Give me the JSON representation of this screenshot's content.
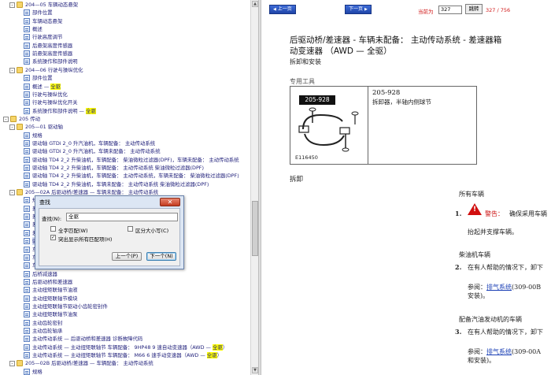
{
  "tree": {
    "rows": [
      {
        "depth": 1,
        "type": "folder",
        "toggle": "-",
        "label": "204—05 车辆动态悬架"
      },
      {
        "depth": 2,
        "type": "doc",
        "label": "部件位置"
      },
      {
        "depth": 2,
        "type": "doc",
        "label": "车辆动态悬架"
      },
      {
        "depth": 2,
        "type": "doc",
        "label": "概述"
      },
      {
        "depth": 2,
        "type": "doc",
        "label": "行驶高度调节"
      },
      {
        "depth": 2,
        "type": "doc",
        "label": "后悬架高度传感器"
      },
      {
        "depth": 2,
        "type": "doc",
        "label": "前悬架高度传感器"
      },
      {
        "depth": 2,
        "type": "doc",
        "label": "系统操作和部件说明"
      },
      {
        "depth": 1,
        "type": "folder",
        "toggle": "-",
        "label": "204—06 行驶与操纵优化"
      },
      {
        "depth": 2,
        "type": "doc",
        "label": "部件位置"
      },
      {
        "depth": 2,
        "type": "doc",
        "label": "概述 — ",
        "hl": "全驱",
        "after": ""
      },
      {
        "depth": 2,
        "type": "doc",
        "label": "行驶与操纵优化"
      },
      {
        "depth": 2,
        "type": "doc",
        "label": "行驶与操纵优化开关"
      },
      {
        "depth": 2,
        "type": "doc",
        "label": "系统操作和部件说明 — ",
        "hl": "全驱",
        "after": ""
      },
      {
        "depth": 0,
        "type": "folder",
        "toggle": "-",
        "label": "205 传动"
      },
      {
        "depth": 1,
        "type": "folder",
        "toggle": "-",
        "label": "205—01 驱动轴"
      },
      {
        "depth": 2,
        "type": "doc",
        "label": "规格"
      },
      {
        "depth": 2,
        "type": "doc",
        "label": "驱动轴 GTDi 2_0 升汽油机，车辆配备： 主动传动系统"
      },
      {
        "depth": 2,
        "type": "doc",
        "label": "驱动轴 GTDi 2_0 升汽油机，车辆未配备： 主动传动系统"
      },
      {
        "depth": 2,
        "type": "doc",
        "label": "驱动轴 TD4 2_2 升柴油机，车辆配备： 柴油微粒过滤器(DPF)，车辆未配备： 主动传动系统"
      },
      {
        "depth": 2,
        "type": "doc",
        "label": "驱动轴 TD4 2_2 升柴油机，车辆配备： 主动传动系统 柴油微粒过滤器(DPF)"
      },
      {
        "depth": 2,
        "type": "doc",
        "label": "驱动轴 TD4 2_2 升柴油机，车辆配备： 主动传动系统，车辆未配备： 柴油微粒过滤器(DPF)"
      },
      {
        "depth": 2,
        "type": "doc",
        "label": "驱动轴 TD4 2_2 升柴油机，车辆未配备： 主动传动系统 柴油微粒过滤器(DPF)"
      },
      {
        "depth": 1,
        "type": "folder",
        "toggle": "-",
        "label": "205—02A 后驱动桥/差速器 — 车辆未配备： 主动传动系统"
      },
      {
        "depth": 2,
        "type": "doc",
        "label": "规格"
      },
      {
        "depth": 2,
        "type": "doc",
        "label": "差速"
      },
      {
        "depth": 2,
        "type": "doc",
        "label": "差速"
      },
      {
        "depth": 2,
        "type": "doc",
        "label": "差速"
      },
      {
        "depth": 2,
        "type": "doc",
        "label": "差速"
      },
      {
        "depth": 2,
        "type": "doc",
        "label": "驱动                                                                变速器（AWD — ",
        "hl": "全驱",
        "after": "）",
        "selected": true
      },
      {
        "depth": 2,
        "type": "doc",
        "label": "车辆                                                                 （AWD — ",
        "hl": "全驱",
        "after": "）"
      },
      {
        "depth": 2,
        "type": "doc",
        "label": "车辆                                                                 动变速器（AWD — ",
        "hl": "全驱",
        "after": "）"
      },
      {
        "depth": 2,
        "type": "doc",
        "label": "车辆                                                                   动变速器（AWD — ",
        "hl": "全驱",
        "after": "）"
      },
      {
        "depth": 2,
        "type": "doc",
        "label": "后桥减速器"
      },
      {
        "depth": 2,
        "type": "doc",
        "label": "后驱动桥和差速器"
      },
      {
        "depth": 2,
        "type": "doc",
        "label": "主动扭矩联轴节油液"
      },
      {
        "depth": 2,
        "type": "doc",
        "label": "主动扭矩联轴节模块"
      },
      {
        "depth": 2,
        "type": "doc",
        "label": "主动扭矩联轴节驱动小齿轮密封件"
      },
      {
        "depth": 2,
        "type": "doc",
        "label": "主动扭矩联轴节油泵"
      },
      {
        "depth": 2,
        "type": "doc",
        "label": "主动齿轮密封"
      },
      {
        "depth": 2,
        "type": "doc",
        "label": "主动齿轮轴承"
      },
      {
        "depth": 2,
        "type": "doc",
        "label": "主动传动系统 — 后驱动桥和差速器 诊断故障代码"
      },
      {
        "depth": 2,
        "type": "doc",
        "label": "主动传动系统 — 主动扭矩联轴节 车辆配备： 9HP48 9 速自动变速器（AWD — ",
        "hl": "全驱",
        "after": "）"
      },
      {
        "depth": 2,
        "type": "doc",
        "label": "主动传动系统 — 主动扭矩联轴节 车辆配备： M66 6 速手动变速器（AWD — ",
        "hl": "全驱",
        "after": "）"
      },
      {
        "depth": 1,
        "type": "folder",
        "toggle": "-",
        "label": "205—02B 后驱动桥/差速器 — 车辆配备： 主动传动系统"
      },
      {
        "depth": 2,
        "type": "doc",
        "label": "规格"
      }
    ]
  },
  "toolbar": {
    "prev_label": "上一页",
    "next_label": "下一页",
    "page_label": "当前为",
    "page_value": "327",
    "jump_label": "跳转",
    "page_count": "327 / 756"
  },
  "document": {
    "title_line1": "后驱动桥/差速器 - 车辆未配备： 主动传动系统 - 差速器箱",
    "title_line2": "动变速器 （AWD — 全驱）",
    "subtitle": "拆卸和安装",
    "tools_heading": "专用工具",
    "tool_badge": "205-928",
    "tool_number": "205-928",
    "tool_desc": "拆卸器，半轴内侧球节",
    "tool_img_code": "E116450",
    "removal_heading": "拆卸",
    "all_vehicles": "所有车辆",
    "step1_num": "1.",
    "step1_warn": "警告：",
    "step1_text": "确保采用车辆",
    "step1_cont": "抬起并支撑车辆。",
    "diesel_heading": "柴油机车辆",
    "step2_num": "2.",
    "step2_text": "在有人帮助的情况下，卸下",
    "step2_ref_pre": "参阅：",
    "step2_ref_link": "排气系统",
    "step2_ref_post": "(309-00B",
    "step2_ref_line2": "安装)。",
    "petrol_heading": "配备汽油发动机的车辆",
    "step3_num": "3.",
    "step3_text": "在有人帮助的情况下，卸下",
    "step3_ref_pre": "参阅：",
    "step3_ref_link": "排气系统",
    "step3_ref_post": "(309-00A",
    "step3_ref_line2": "和安装)。"
  },
  "find_dialog": {
    "title": "查找",
    "close_glyph": "✕",
    "find_label": "查找(N):",
    "find_value": "全驱",
    "match_whole": "全字匹配(W)",
    "match_case": "区分大小写(C)",
    "highlight_all": "突出显示所有匹配项(H)",
    "highlight_checked": "✓",
    "prev_btn": "上一个(P)",
    "next_btn": "下一个(N)"
  }
}
